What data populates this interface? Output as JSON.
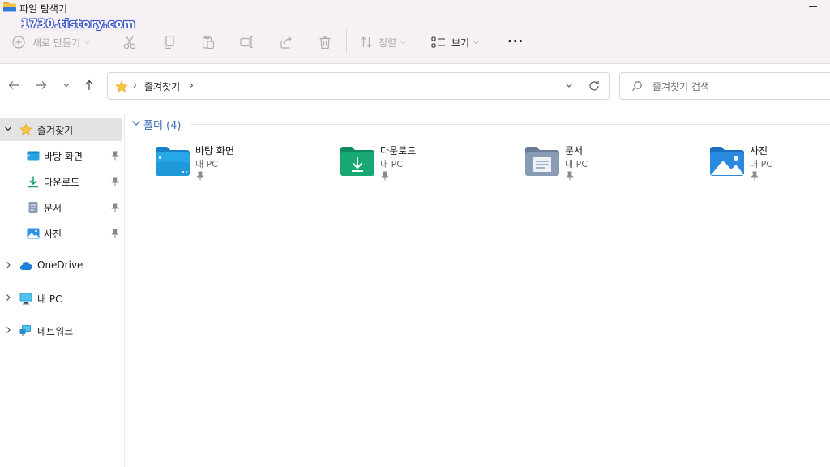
{
  "window": {
    "title": "파일 탐색기"
  },
  "watermark": "1730.tistory.com",
  "toolbar": {
    "new_label": "새로 만들기",
    "sort_label": "정렬",
    "view_label": "보기",
    "more_glyph": "•••",
    "chevron": "⌵"
  },
  "address": {
    "path_sep": "›",
    "location": "즐겨찾기",
    "trailing_sep": "›"
  },
  "search": {
    "placeholder": "즐겨찾기 검색"
  },
  "sidebar": {
    "items": [
      {
        "label": "즐겨찾기",
        "icon": "star-icon",
        "selected": true
      },
      {
        "label": "바탕 화면",
        "icon": "desktop-icon",
        "pinned": true
      },
      {
        "label": "다운로드",
        "icon": "download-icon",
        "pinned": true
      },
      {
        "label": "문서",
        "icon": "document-icon",
        "pinned": true
      },
      {
        "label": "사진",
        "icon": "pictures-icon",
        "pinned": true
      },
      {
        "label": "OneDrive",
        "icon": "cloud-icon"
      },
      {
        "label": "내 PC",
        "icon": "monitor-icon"
      },
      {
        "label": "네트워크",
        "icon": "network-icon"
      }
    ]
  },
  "content": {
    "group_label": "폴더 (4)",
    "folders": [
      {
        "name": "바탕 화면",
        "location": "내 PC",
        "icon": "desktop-folder-icon"
      },
      {
        "name": "다운로드",
        "location": "내 PC",
        "icon": "download-folder-icon"
      },
      {
        "name": "문서",
        "location": "내 PC",
        "icon": "document-folder-icon"
      },
      {
        "name": "사진",
        "location": "내 PC",
        "icon": "pictures-folder-icon"
      }
    ]
  },
  "colors": {
    "accent": "#3e6cb5",
    "toolbar_bg": "#f7f0f4",
    "selection_bg": "#e3e3e3",
    "folder_yellow": "#f4c542"
  }
}
